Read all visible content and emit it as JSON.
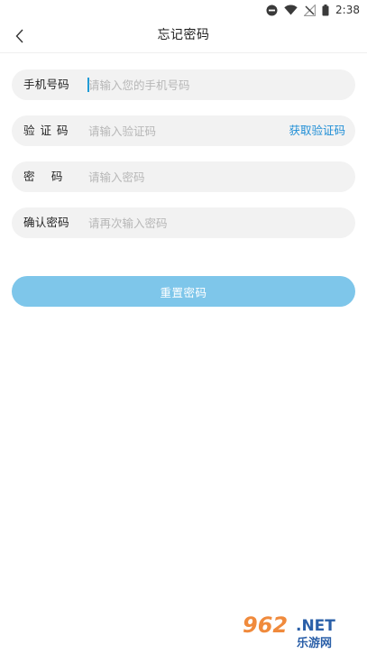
{
  "status_bar": {
    "time": "2:38",
    "icons": [
      "minus-circle-icon",
      "wifi-icon",
      "no-signal-icon",
      "battery-icon"
    ]
  },
  "header": {
    "title": "忘记密码",
    "back_icon": "chevron-left-icon"
  },
  "form": {
    "phone": {
      "label": "手机号码",
      "placeholder": "请输入您的手机号码",
      "value": ""
    },
    "code": {
      "label": "验 证 码",
      "placeholder": "请输入验证码",
      "value": "",
      "action_label": "获取验证码"
    },
    "password": {
      "label": "密 码",
      "placeholder": "请输入密码",
      "value": ""
    },
    "confirm": {
      "label": "确认密码",
      "placeholder": "请再次输入密码",
      "value": ""
    }
  },
  "submit": {
    "label": "重置密码"
  },
  "watermark": {
    "text_top": "962.NET",
    "text_bottom": "乐游网"
  },
  "colors": {
    "accent": "#1f8ed6",
    "button": "#7ec6ea",
    "field_bg": "#f2f2f2",
    "placeholder": "#b7b7b7"
  }
}
